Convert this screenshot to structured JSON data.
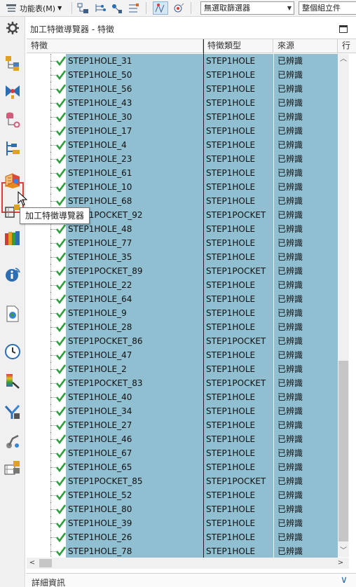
{
  "toolbar": {
    "function_menu_label": "功能表(M)",
    "filter_select": "無選取篩選器",
    "scope_select": "整個組立件"
  },
  "rail": {
    "tooltip": "加工特徵導覽器",
    "icons": [
      "gear-icon",
      "assembly-navigator-icon",
      "constraint-navigator-icon",
      "part-navigator-icon",
      "reuse-library-icon",
      "machining-feature-navigator-icon",
      "hd3d-tools-icon",
      "role-icon",
      "info-icon",
      "web-browser-icon",
      "history-icon",
      "palette-icon",
      "system-materials-icon",
      "process-studio-icon",
      "part-family-icon"
    ],
    "accent_color": "#e23b3b"
  },
  "panel": {
    "title": "加工特徵導覽器 - 特徵",
    "columns": [
      "特徵",
      "特徵類型",
      "來源"
    ],
    "truncated_column": "行",
    "selection_color": "#8fbfd0",
    "check_color": "#2e9e3e",
    "rows": [
      {
        "name": "STEP1HOLE_31",
        "type": "STEP1HOLE",
        "source": "已辨識"
      },
      {
        "name": "STEP1HOLE_50",
        "type": "STEP1HOLE",
        "source": "已辨識"
      },
      {
        "name": "STEP1HOLE_56",
        "type": "STEP1HOLE",
        "source": "已辨識"
      },
      {
        "name": "STEP1HOLE_43",
        "type": "STEP1HOLE",
        "source": "已辨識"
      },
      {
        "name": "STEP1HOLE_30",
        "type": "STEP1HOLE",
        "source": "已辨識"
      },
      {
        "name": "STEP1HOLE_17",
        "type": "STEP1HOLE",
        "source": "已辨識"
      },
      {
        "name": "STEP1HOLE_4",
        "type": "STEP1HOLE",
        "source": "已辨識"
      },
      {
        "name": "STEP1HOLE_23",
        "type": "STEP1HOLE",
        "source": "已辨識"
      },
      {
        "name": "STEP1HOLE_61",
        "type": "STEP1HOLE",
        "source": "已辨識"
      },
      {
        "name": "STEP1HOLE_10",
        "type": "STEP1HOLE",
        "source": "已辨識"
      },
      {
        "name": "STEP1HOLE_68",
        "type": "STEP1HOLE",
        "source": "已辨識"
      },
      {
        "name": "STEP1POCKET_92",
        "type": "STEP1POCKET",
        "source": "已辨識"
      },
      {
        "name": "STEP1HOLE_48",
        "type": "STEP1HOLE",
        "source": "已辨識"
      },
      {
        "name": "STEP1HOLE_77",
        "type": "STEP1HOLE",
        "source": "已辨識"
      },
      {
        "name": "STEP1HOLE_35",
        "type": "STEP1HOLE",
        "source": "已辨識"
      },
      {
        "name": "STEP1POCKET_89",
        "type": "STEP1POCKET",
        "source": "已辨識"
      },
      {
        "name": "STEP1HOLE_22",
        "type": "STEP1HOLE",
        "source": "已辨識"
      },
      {
        "name": "STEP1HOLE_64",
        "type": "STEP1HOLE",
        "source": "已辨識"
      },
      {
        "name": "STEP1HOLE_9",
        "type": "STEP1HOLE",
        "source": "已辨識"
      },
      {
        "name": "STEP1HOLE_28",
        "type": "STEP1HOLE",
        "source": "已辨識"
      },
      {
        "name": "STEP1POCKET_86",
        "type": "STEP1POCKET",
        "source": "已辨識"
      },
      {
        "name": "STEP1HOLE_47",
        "type": "STEP1HOLE",
        "source": "已辨識"
      },
      {
        "name": "STEP1HOLE_2",
        "type": "STEP1HOLE",
        "source": "已辨識"
      },
      {
        "name": "STEP1POCKET_83",
        "type": "STEP1POCKET",
        "source": "已辨識"
      },
      {
        "name": "STEP1HOLE_40",
        "type": "STEP1HOLE",
        "source": "已辨識"
      },
      {
        "name": "STEP1HOLE_34",
        "type": "STEP1HOLE",
        "source": "已辨識"
      },
      {
        "name": "STEP1HOLE_27",
        "type": "STEP1HOLE",
        "source": "已辨識"
      },
      {
        "name": "STEP1HOLE_46",
        "type": "STEP1HOLE",
        "source": "已辨識"
      },
      {
        "name": "STEP1HOLE_67",
        "type": "STEP1HOLE",
        "source": "已辨識"
      },
      {
        "name": "STEP1HOLE_65",
        "type": "STEP1HOLE",
        "source": "已辨識"
      },
      {
        "name": "STEP1POCKET_85",
        "type": "STEP1POCKET",
        "source": "已辨識"
      },
      {
        "name": "STEP1HOLE_52",
        "type": "STEP1HOLE",
        "source": "已辨識"
      },
      {
        "name": "STEP1HOLE_80",
        "type": "STEP1HOLE",
        "source": "已辨識"
      },
      {
        "name": "STEP1HOLE_39",
        "type": "STEP1HOLE",
        "source": "已辨識"
      },
      {
        "name": "STEP1HOLE_26",
        "type": "STEP1HOLE",
        "source": "已辨識"
      },
      {
        "name": "STEP1HOLE_78",
        "type": "STEP1HOLE",
        "source": "已辨識"
      }
    ]
  },
  "details": {
    "label": "詳細資訊"
  }
}
